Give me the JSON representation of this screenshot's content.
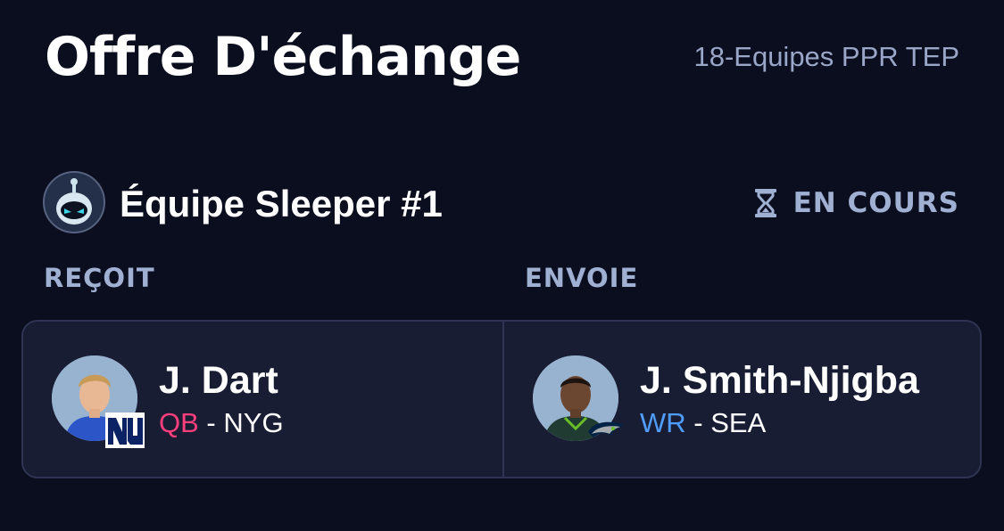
{
  "header": {
    "title": "Offre D'échange",
    "league": "18-Equipes PPR TEP"
  },
  "team": {
    "name": "Équipe Sleeper #1",
    "status": "EN COURS",
    "status_icon": "hourglass-icon"
  },
  "columns": {
    "receives": "REÇOIT",
    "sends": "ENVOIE"
  },
  "players": {
    "receive": {
      "name": "J. Dart",
      "position": "QB",
      "separator": "-",
      "team": "NYG"
    },
    "send": {
      "name": "J. Smith-Njigba",
      "position": "WR",
      "separator": "-",
      "team": "SEA"
    }
  },
  "colors": {
    "background": "#0b0e1f",
    "card": "#191d33",
    "qb": "#ff3f7d",
    "wr": "#4f9dff",
    "muted": "#9fb0d3"
  }
}
